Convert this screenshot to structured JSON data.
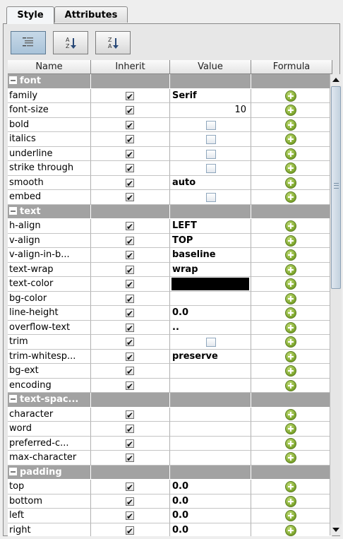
{
  "tabs": [
    {
      "label": "Style",
      "active": true
    },
    {
      "label": "Attributes",
      "active": false
    }
  ],
  "toolbar": {
    "buttons": [
      {
        "name": "categorized-view-icon",
        "pressed": true
      },
      {
        "name": "sort-ascending-icon",
        "pressed": false
      },
      {
        "name": "sort-descending-icon",
        "pressed": false
      }
    ]
  },
  "columns": [
    "Name",
    "Inherit",
    "Value",
    "Formula"
  ],
  "groups": [
    {
      "title": "font",
      "rows": [
        {
          "name": "family",
          "value": "Serif",
          "type": "text"
        },
        {
          "name": "font-size",
          "value": "10",
          "type": "number"
        },
        {
          "name": "bold",
          "value": "",
          "type": "checkbox"
        },
        {
          "name": "italics",
          "value": "",
          "type": "checkbox"
        },
        {
          "name": "underline",
          "value": "",
          "type": "checkbox"
        },
        {
          "name": "strike through",
          "value": "",
          "type": "checkbox"
        },
        {
          "name": "smooth",
          "value": "auto",
          "type": "text"
        },
        {
          "name": "embed",
          "value": "",
          "type": "checkbox"
        }
      ]
    },
    {
      "title": "text",
      "rows": [
        {
          "name": "h-align",
          "value": "LEFT",
          "type": "text"
        },
        {
          "name": "v-align",
          "value": "TOP",
          "type": "text"
        },
        {
          "name": "v-align-in-b...",
          "value": "baseline",
          "type": "text"
        },
        {
          "name": "text-wrap",
          "value": "wrap",
          "type": "text"
        },
        {
          "name": "text-color",
          "value": "#000000",
          "type": "color"
        },
        {
          "name": "bg-color",
          "value": "",
          "type": "text"
        },
        {
          "name": "line-height",
          "value": "0.0",
          "type": "text"
        },
        {
          "name": "overflow-text",
          "value": "..",
          "type": "text"
        },
        {
          "name": "trim",
          "value": "",
          "type": "checkbox"
        },
        {
          "name": "trim-whitesp...",
          "value": "preserve",
          "type": "text"
        },
        {
          "name": "bg-ext",
          "value": "",
          "type": "text"
        },
        {
          "name": "encoding",
          "value": "",
          "type": "text"
        }
      ]
    },
    {
      "title": "text-spac...",
      "rows": [
        {
          "name": "character",
          "value": "",
          "type": "text"
        },
        {
          "name": "word",
          "value": "",
          "type": "text"
        },
        {
          "name": "preferred-c...",
          "value": "",
          "type": "text"
        },
        {
          "name": "max-character",
          "value": "",
          "type": "text"
        }
      ]
    },
    {
      "title": "padding",
      "rows": [
        {
          "name": "top",
          "value": "0.0",
          "type": "text"
        },
        {
          "name": "bottom",
          "value": "0.0",
          "type": "text"
        },
        {
          "name": "left",
          "value": "0.0",
          "type": "text"
        },
        {
          "name": "right",
          "value": "0.0",
          "type": "text"
        }
      ]
    }
  ],
  "colors": {
    "group_header": "#a2a2a2",
    "formula_icon": "#7aa32a"
  }
}
